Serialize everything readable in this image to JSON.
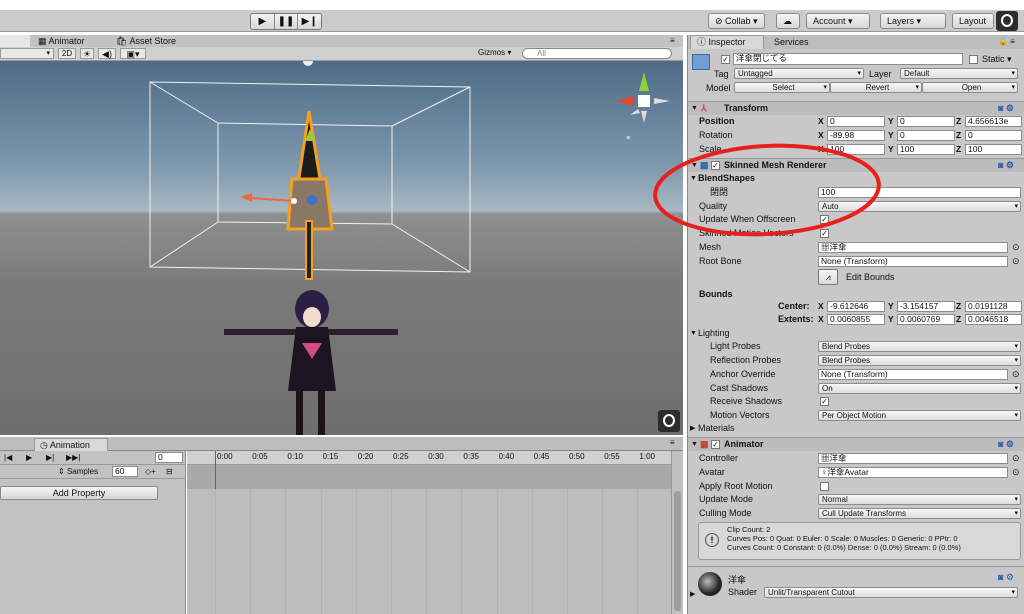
{
  "toolbar": {
    "play_icon": "play-icon",
    "pause_icon": "pause-icon",
    "step_icon": "step-icon",
    "collab": "Collab ▾",
    "account": "Account",
    "layers": "Layers",
    "layout": "Layout"
  },
  "scene": {
    "tab_animator": "Animator",
    "tab_asset_store": "Asset Store",
    "mode_2d": "2D",
    "gizmos": "Gizmos",
    "search_placeholder": "All"
  },
  "inspector": {
    "tab_inspector": "Inspector",
    "tab_services": "Services",
    "object_name": "洋傘閉じてる",
    "static_label": "Static",
    "tag_label": "Tag",
    "tag_value": "Untagged",
    "layer_label": "Layer",
    "layer_value": "Default",
    "model_label": "Model",
    "model_select": "Select",
    "model_revert": "Revert",
    "model_open": "Open",
    "transform": {
      "title": "Transform",
      "position_label": "Position",
      "rotation_label": "Rotation",
      "scale_label": "Scale",
      "pos_x": "0",
      "pos_y": "0",
      "pos_z": "4.656613e",
      "rot_x": "-89.98",
      "rot_y": "0",
      "rot_z": "0",
      "scale_x": "100",
      "scale_y": "100",
      "scale_z": "100"
    },
    "smr": {
      "title": "Skinned Mesh Renderer",
      "blendshapes_label": "BlendShapes",
      "blendshape_name": "閉閉",
      "blendshape_value": "100",
      "quality_label": "Quality",
      "quality_value": "Auto",
      "update_offscreen_label": "Update When Offscreen",
      "skinned_motion_label": "Skinned Motion Vectors",
      "mesh_label": "Mesh",
      "mesh_value": "洋傘",
      "root_bone_label": "Root Bone",
      "root_bone_value": "None (Transform)",
      "edit_bounds": "Edit Bounds",
      "bounds_label": "Bounds",
      "center_label": "Center:",
      "extents_label": "Extents:",
      "center_x": "-9.612646",
      "center_y": "-3.154157",
      "center_z": "0.0191128",
      "extents_x": "0.0060855",
      "extents_y": "0.0060769",
      "extents_z": "0.0046518",
      "lighting_label": "Lighting",
      "light_probes_label": "Light Probes",
      "light_probes_value": "Blend Probes",
      "reflection_probes_label": "Reflection Probes",
      "reflection_probes_value": "Blend Probes",
      "anchor_override_label": "Anchor Override",
      "anchor_override_value": "None (Transform)",
      "cast_shadows_label": "Cast Shadows",
      "cast_shadows_value": "On",
      "receive_shadows_label": "Receive Shadows",
      "motion_vectors_label": "Motion Vectors",
      "motion_vectors_value": "Per Object Motion",
      "materials_label": "Materials"
    },
    "animator": {
      "title": "Animator",
      "controller_label": "Controller",
      "controller_value": "洋傘",
      "avatar_label": "Avatar",
      "avatar_value": "洋傘Avatar",
      "apply_root_label": "Apply Root Motion",
      "update_mode_label": "Update Mode",
      "update_mode_value": "Normal",
      "culling_label": "Culling Mode",
      "culling_value": "Cull Update Transforms",
      "info_line1": "Clip Count: 2",
      "info_line2": "Curves Pos: 0 Quat: 0 Euler: 0 Scale: 0 Muscles: 0 Generic: 0 PPtr: 0",
      "info_line3": "Curves Count: 0 Constant: 0 (0.0%) Dense: 0 (0.0%) Stream: 0 (0.0%)"
    },
    "material": {
      "name": "洋傘",
      "shader_label": "Shader",
      "shader_value": "Unlit/Transparent Cutout"
    }
  },
  "animation": {
    "tab": "Animation",
    "frame": "0",
    "samples_label": "Samples",
    "samples_value": "60",
    "add_property": "Add Property",
    "ticks": [
      "0:00",
      "0:05",
      "0:10",
      "0:15",
      "0:20",
      "0:25",
      "0:30",
      "0:35",
      "0:40",
      "0:45",
      "0:50",
      "0:55",
      "1:00"
    ]
  }
}
